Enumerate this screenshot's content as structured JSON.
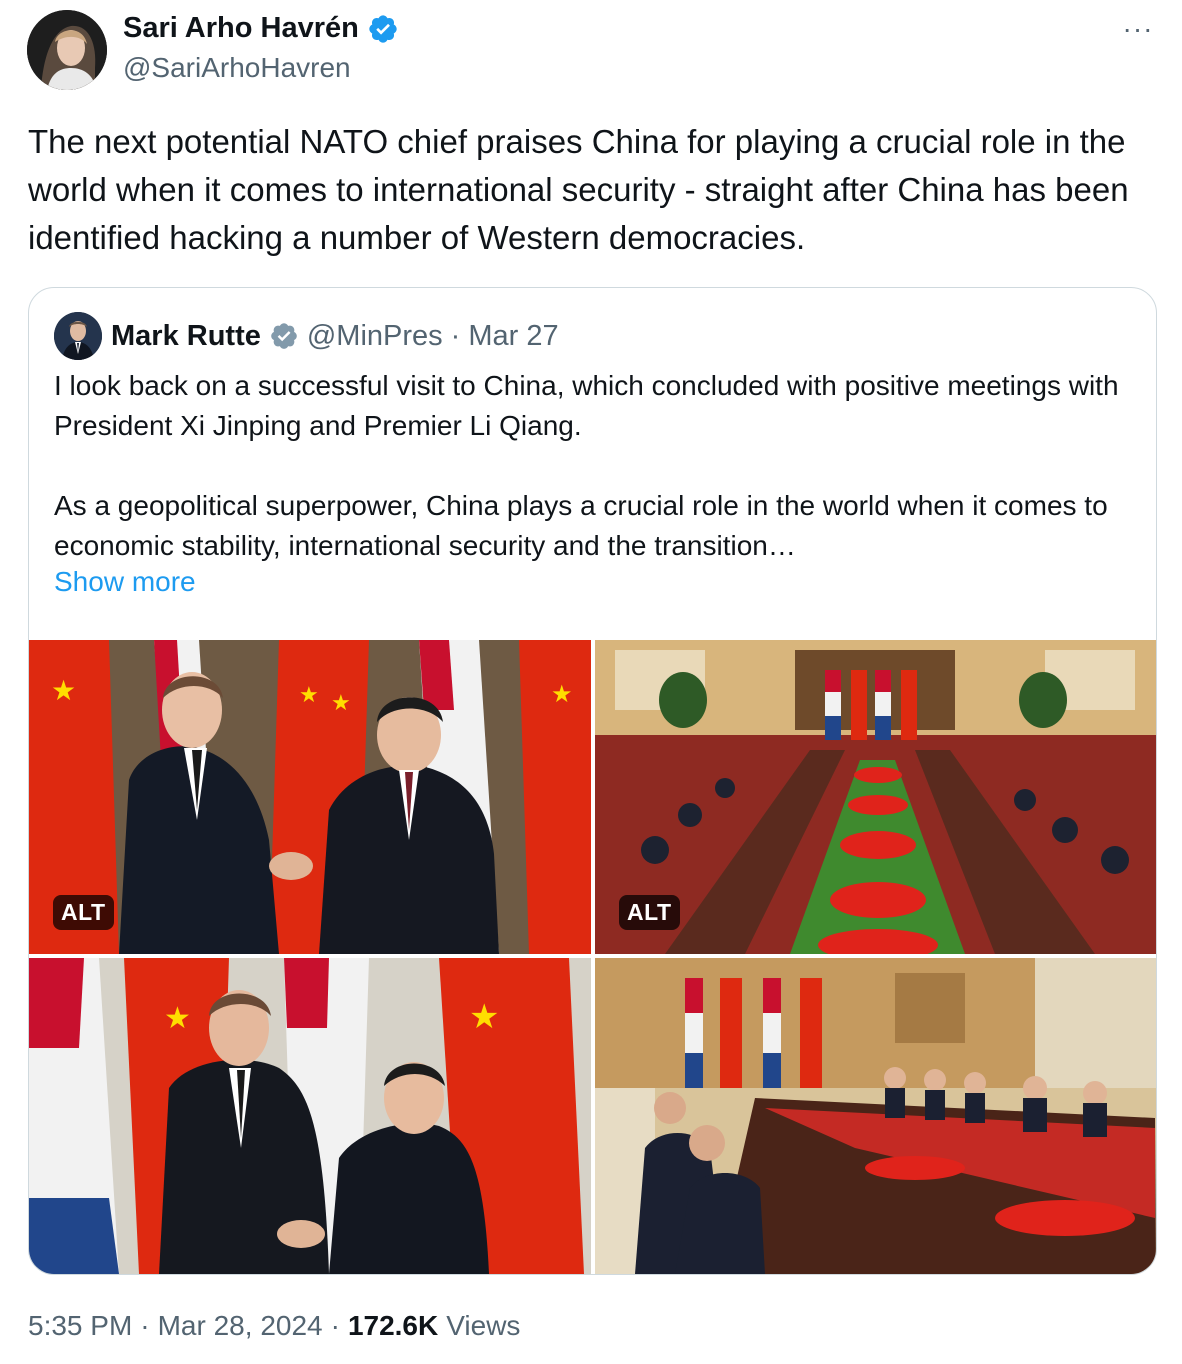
{
  "author": {
    "name": "Sari Arho Havrén",
    "handle": "@SariArhoHavren",
    "verified_icon": "verified-badge-icon",
    "avatar": "author-avatar"
  },
  "tweet": {
    "text": "The next potential NATO chief praises China for playing a crucial role in the world when it comes to international security - straight after China has been identified hacking a number of Western democracies."
  },
  "menu_icon": "more-dots-icon",
  "menu_glyph": "···",
  "quote": {
    "name": "Mark Rutte",
    "handle": "@MinPres",
    "dot": "·",
    "date": "Mar 27",
    "paragraph1": "I look back on a successful visit to China, which concluded with positive meetings with President Xi Jinping and Premier Li Qiang.",
    "paragraph2": "As a geopolitical superpower, China plays a crucial role in the world when it comes to economic stability, international security and the transition…",
    "show_more": "Show more"
  },
  "media": {
    "alt_label": "ALT",
    "tiles": [
      "photo-handshake-xi",
      "photo-meeting-table",
      "photo-handshake-li",
      "photo-meeting-room"
    ]
  },
  "footer": {
    "time": "5:35 PM",
    "dot": "·",
    "date": "Mar 28, 2024",
    "dot2": "·",
    "views_count": "172.6K",
    "views_label": "Views"
  },
  "colors": {
    "verified_blue": "#1d9bf0",
    "verified_gray": "#829aab",
    "secondary_text": "#536471",
    "link": "#1d9bf0",
    "china_red": "#de2910",
    "china_star": "#ffde00"
  }
}
